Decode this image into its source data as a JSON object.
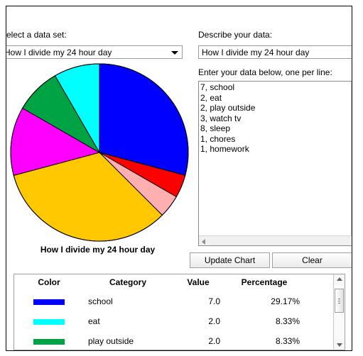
{
  "dataset_selector": {
    "label": "Select a data set:",
    "selected": "How I divide my 24 hour day",
    "arrow_icon": "chevron-down-icon"
  },
  "describe": {
    "label": "Describe your data:",
    "value": "How I divide my 24 hour day"
  },
  "data_entry": {
    "label": "Enter your data below, one per line:",
    "value": "7, school\n2, eat\n2, play outside\n3, watch tv\n8, sleep\n1, chores\n1, homework"
  },
  "buttons": {
    "update": "Update Chart",
    "clear": "Clear"
  },
  "chart_data": {
    "type": "pie",
    "title": "How I divide my 24 hour day",
    "total": 24,
    "start_angle_deg": 90,
    "direction": "clockwise",
    "categories": [
      "school",
      "eat",
      "play outside",
      "watch tv",
      "sleep",
      "chores",
      "homework"
    ],
    "values": [
      7.0,
      2.0,
      2.0,
      3.0,
      8.0,
      1.0,
      1.0
    ],
    "percentages": [
      "29.17%",
      "8.33%",
      "8.33%",
      "12.50%",
      "33.33%",
      "4.17%",
      "4.17%"
    ],
    "colors": [
      "#0000FF",
      "#00FFFF",
      "#00A344",
      "#FF00FF",
      "#FFC800",
      "#FFAFAF",
      "#FF0000"
    ],
    "slice_order_clockwise": [
      "school",
      "homework",
      "chores",
      "sleep",
      "watch tv",
      "play outside",
      "eat"
    ],
    "outline_color": "#000000",
    "legend_position": "below-table"
  },
  "legend_table": {
    "headers": [
      "Color",
      "Category",
      "Value",
      "Percentage"
    ],
    "rows": [
      {
        "color": "#0000FF",
        "category": "school",
        "value": "7.0",
        "percentage": "29.17%"
      },
      {
        "color": "#00FFFF",
        "category": "eat",
        "value": "2.0",
        "percentage": "8.33%"
      },
      {
        "color": "#00A344",
        "category": "play outside",
        "value": "2.0",
        "percentage": "8.33%"
      }
    ]
  }
}
